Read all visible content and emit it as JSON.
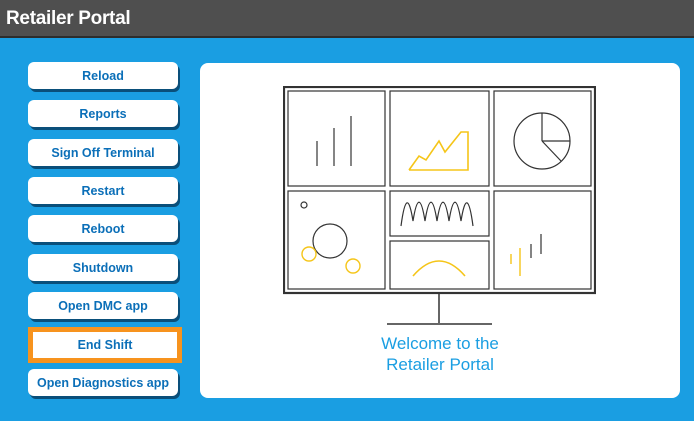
{
  "app": {
    "title": "Retailer Portal"
  },
  "sidebar": {
    "buttons": [
      {
        "label": "Reload"
      },
      {
        "label": "Reports"
      },
      {
        "label": "Sign Off Terminal"
      },
      {
        "label": "Restart"
      },
      {
        "label": "Reboot"
      },
      {
        "label": "Shutdown"
      },
      {
        "label": "Open DMC app"
      },
      {
        "label": "End Shift",
        "selected": true
      },
      {
        "label": "Open Diagnostics app"
      }
    ]
  },
  "main": {
    "illustration_icon": "dashboard-monitor-icon",
    "welcome_line1": "Welcome to the",
    "welcome_line2": "Retailer Portal"
  },
  "colors": {
    "titlebar": "#4f4f4f",
    "background": "#1a9ee2",
    "button_text": "#0b6fb8",
    "selected_outline": "#f7931e",
    "accent_yellow": "#f5c518"
  }
}
